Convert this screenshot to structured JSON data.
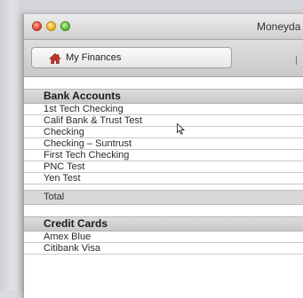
{
  "window": {
    "title": "Moneyda",
    "traffic_lights": [
      "close",
      "minimize",
      "zoom"
    ]
  },
  "toolbar": {
    "home_icon": "house-icon",
    "my_finances_label": "My Finances"
  },
  "sections": [
    {
      "header": "Bank Accounts",
      "items": [
        "1st Tech Checking",
        "Calif Bank & Trust Test",
        "Checking",
        "Checking – Suntrust",
        "First Tech Checking",
        "PNC Test",
        "Yen Test"
      ],
      "total_label": "Total"
    },
    {
      "header": "Credit Cards",
      "items": [
        "Amex Blue",
        "Citibank Visa"
      ]
    }
  ],
  "colors": {
    "close": "#e0442f",
    "minimize": "#f1b31b",
    "zoom": "#5dbb32",
    "home_icon": "#c8342a"
  }
}
